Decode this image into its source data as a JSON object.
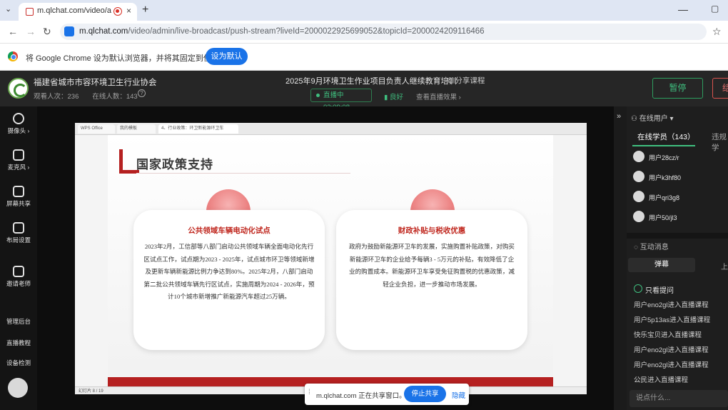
{
  "browser": {
    "tab_title": "m.qlchat.com/video/adm",
    "new_tab": "+",
    "close_tab": "×",
    "url_host": "m.qlchat.com",
    "url_path": "/video/admin/live-broadcast/push-stream?liveId=2000022925699052&topicId=2000024209116466",
    "infobar_text": "将 Google Chrome 设为默认浏览器，并将其固定到任务栏",
    "infobar_button": "设为默认"
  },
  "header": {
    "org_name": "福建省城市市容环境卫生行业协会",
    "views_label": "观看人次：236",
    "online_label": "在线人数：143",
    "course_title": "2025年9月环境卫生作业项目负责人继续教育培训",
    "share_label": "分享课程",
    "live_status": "直播中 03:09:08",
    "signal": "良好",
    "view_effect": "查看直播效果 ›",
    "pause_button": "暂停",
    "end_button": "结"
  },
  "sidebar": {
    "items": [
      {
        "label": "摄像头 ›"
      },
      {
        "label": "麦克风 ›"
      },
      {
        "label": "屏幕共享"
      },
      {
        "label": "布局设置"
      },
      {
        "label": "邀请老师"
      }
    ],
    "links": [
      "管理后台",
      "直播教程",
      "设备检测"
    ]
  },
  "slide": {
    "app_tabs": [
      "WPS Office",
      "我的模板",
      "4、行业政策：环卫新能源环卫车"
    ],
    "title": "国家政策支持",
    "card1_title": "公共领域车辆电动化试点",
    "card1_body": "2023年2月，工信部等八部门启动公共领域车辆全面电动化先行区试点工作，试点期为2023 - 2025年，试点城市环卫等领域新增及更新车辆新能源比例力争达到80%。2025年2月，八部门启动第二批公共领域车辆先行区试点，实施周期为2024 - 2026年，预计10个城市新增推广新能源汽车超过25万辆。",
    "card2_title": "财政补贴与税收优惠",
    "card2_body": "政府为鼓励新能源环卫车的发展，实施购置补贴政策，对购买新能源环卫车的企业给予每辆3 - 5万元的补贴，有效降低了企业的购置成本。新能源环卫车享受免征购置税的优惠政策，减轻企业负担，进一步推动市场发展。",
    "page_indicator": "幻灯片 8 / 19"
  },
  "share_bar": {
    "text": "m.qlchat.com 正在共享窗口。",
    "stop": "停止共享",
    "hide": "隐藏"
  },
  "right_panel": {
    "dropdown": "在线用户 ▾",
    "tab_students": "在线学员（143）",
    "tab_violations": "违规学",
    "users": [
      "用户28cz/r",
      "用户k3hf80",
      "用户qri3g8",
      "用户50/jl3"
    ],
    "messages_title": "互动消息",
    "danmu_tab": "弹幕",
    "danmu_tab2": "上",
    "only_questions": "只看提问",
    "messages": [
      "用户eno2gl进入直播课程",
      "用户5p13as进入直播课程",
      "快乐宝贝进入直播课程",
      "用户eno2gl进入直播课程",
      "用户eno2gl进入直播课程",
      "公民进入直播课程"
    ],
    "input_placeholder": "说点什么..."
  }
}
